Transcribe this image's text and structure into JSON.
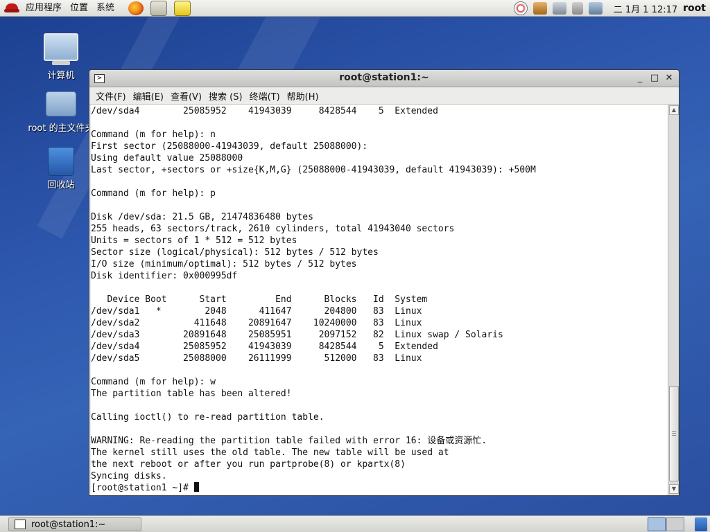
{
  "top_panel": {
    "menus": [
      "应用程序",
      "位置",
      "系统"
    ],
    "clock": "二 1月  1 12:17",
    "user": "root"
  },
  "desktop": {
    "icons": [
      {
        "label": "计算机",
        "icon": "computer-icon"
      },
      {
        "label": "root 的主文件夹",
        "icon": "home-folder-icon"
      },
      {
        "label": "回收站",
        "icon": "trash-icon"
      }
    ]
  },
  "window": {
    "title": "root@station1:~",
    "menus": [
      "文件(F)",
      "编辑(E)",
      "查看(V)",
      "搜索 (S)",
      "终端(T)",
      "帮助(H)"
    ],
    "lines": [
      "/dev/sda4        25085952    41943039     8428544    5  Extended",
      "",
      "Command (m for help): n",
      "First sector (25088000-41943039, default 25088000):",
      "Using default value 25088000",
      "Last sector, +sectors or +size{K,M,G} (25088000-41943039, default 41943039): +500M",
      "",
      "Command (m for help): p",
      "",
      "Disk /dev/sda: 21.5 GB, 21474836480 bytes",
      "255 heads, 63 sectors/track, 2610 cylinders, total 41943040 sectors",
      "Units = sectors of 1 * 512 = 512 bytes",
      "Sector size (logical/physical): 512 bytes / 512 bytes",
      "I/O size (minimum/optimal): 512 bytes / 512 bytes",
      "Disk identifier: 0x000995df",
      "",
      "   Device Boot      Start         End      Blocks   Id  System",
      "/dev/sda1   *        2048      411647      204800   83  Linux",
      "/dev/sda2          411648    20891647    10240000   83  Linux",
      "/dev/sda3        20891648    25085951     2097152   82  Linux swap / Solaris",
      "/dev/sda4        25085952    41943039     8428544    5  Extended",
      "/dev/sda5        25088000    26111999      512000   83  Linux",
      "",
      "Command (m for help): w",
      "The partition table has been altered!",
      "",
      "Calling ioctl() to re-read partition table.",
      "",
      "WARNING: Re-reading the partition table failed with error 16: 设备或资源忙.",
      "The kernel still uses the old table. The new table will be used at",
      "the next reboot or after you run partprobe(8) or kpartx(8)",
      "Syncing disks."
    ],
    "prompt": "[root@station1 ~]# "
  },
  "taskbar": {
    "window_label": "root@station1:~"
  }
}
